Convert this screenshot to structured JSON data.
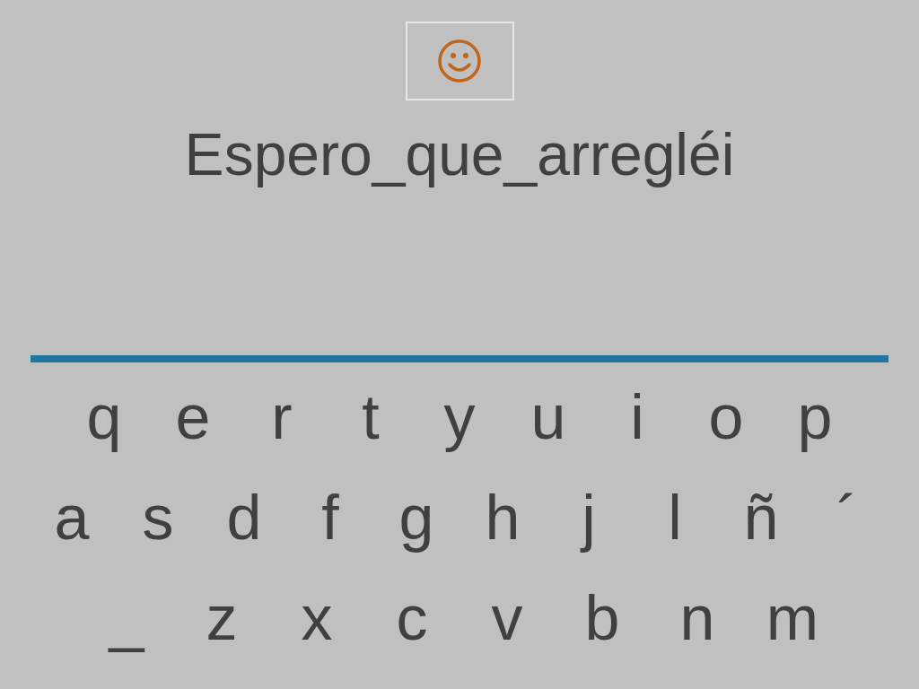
{
  "word": "Espero_que_arregléi",
  "keyboard": {
    "rows": [
      [
        "q",
        "e",
        "r",
        "t",
        "y",
        "u",
        "i",
        "o",
        "p"
      ],
      [
        "a",
        "s",
        "d",
        "f",
        "g",
        "h",
        "j",
        "l",
        "ñ",
        "´"
      ],
      [
        "_",
        "z",
        "x",
        "c",
        "v",
        "b",
        "n",
        "m"
      ]
    ]
  }
}
